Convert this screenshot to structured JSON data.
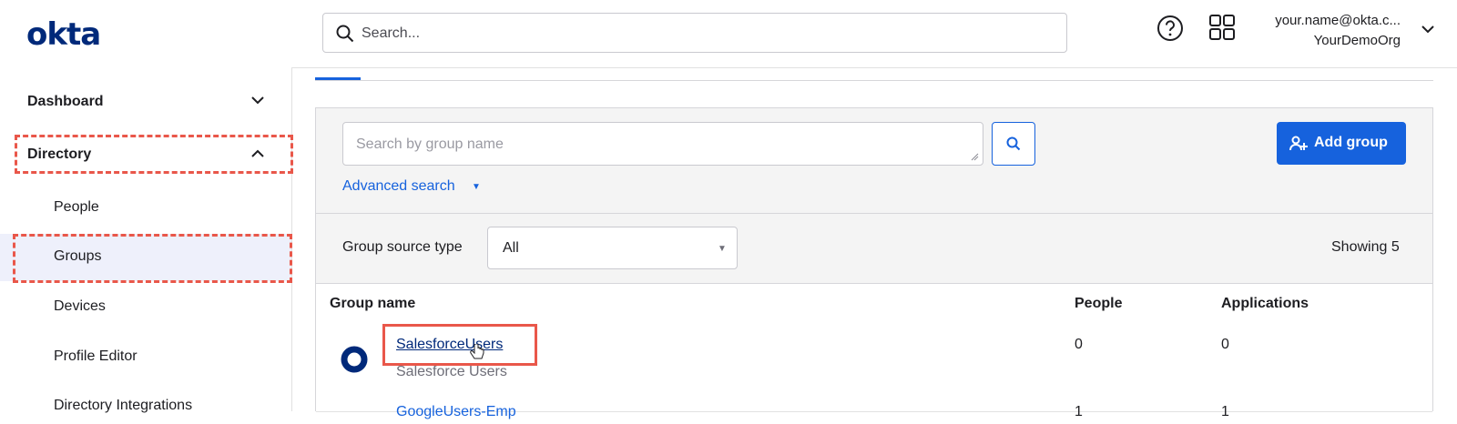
{
  "header": {
    "logo": "okta",
    "search_placeholder": "Search...",
    "user_email": "your.name@okta.c...",
    "org_name": "YourDemoOrg"
  },
  "sidebar": {
    "items": [
      {
        "label": "Dashboard",
        "level": "top",
        "expanded": false
      },
      {
        "label": "Directory",
        "level": "top",
        "expanded": true
      },
      {
        "label": "People",
        "level": "sub"
      },
      {
        "label": "Groups",
        "level": "sub",
        "active": true
      },
      {
        "label": "Devices",
        "level": "sub"
      },
      {
        "label": "Profile Editor",
        "level": "sub"
      },
      {
        "label": "Directory Integrations",
        "level": "sub"
      }
    ]
  },
  "groups_page": {
    "search_placeholder": "Search by group name",
    "advanced_search_label": "Advanced search",
    "add_group_label": "Add group",
    "source_type_label": "Group source type",
    "source_type_value": "All",
    "showing_text": "Showing 5",
    "columns": [
      "Group name",
      "People",
      "Applications"
    ],
    "rows": [
      {
        "name": "SalesforceUsers",
        "description": "Salesforce Users",
        "people": "0",
        "applications": "0"
      },
      {
        "name": "GoogleUsers-Emp",
        "description": "",
        "people": "1",
        "applications": "1"
      }
    ]
  },
  "colors": {
    "brand": "#00297a",
    "accent": "#1662dd",
    "highlight": "#e9574a"
  }
}
